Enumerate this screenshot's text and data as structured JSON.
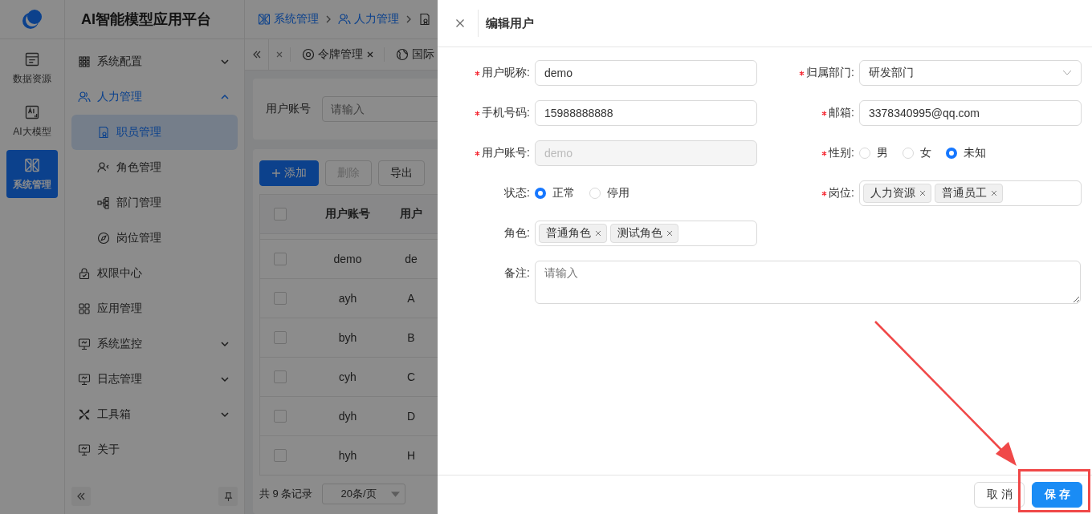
{
  "rail": {
    "items": [
      {
        "label": "数据资源",
        "selected": false
      },
      {
        "label": "AI大模型",
        "selected": false
      },
      {
        "label": "系统管理",
        "selected": true
      }
    ]
  },
  "app_title": "AI智能模型应用平台",
  "sidebar": {
    "items": [
      {
        "label": "系统配置",
        "kind": "group",
        "expanded": false,
        "selected": false
      },
      {
        "label": "人力管理",
        "kind": "group",
        "expanded": true,
        "selected": true,
        "children": [
          {
            "label": "职员管理",
            "selected": true
          },
          {
            "label": "角色管理",
            "selected": false
          },
          {
            "label": "部门管理",
            "selected": false
          },
          {
            "label": "岗位管理",
            "selected": false
          }
        ]
      },
      {
        "label": "权限中心",
        "kind": "link",
        "selected": false
      },
      {
        "label": "应用管理",
        "kind": "link",
        "selected": false
      },
      {
        "label": "系统监控",
        "kind": "group",
        "expanded": false,
        "selected": false
      },
      {
        "label": "日志管理",
        "kind": "group",
        "expanded": false,
        "selected": false
      },
      {
        "label": "工具箱",
        "kind": "group",
        "expanded": false,
        "selected": false
      },
      {
        "label": "关于",
        "kind": "link",
        "selected": false
      }
    ]
  },
  "breadcrumb": [
    "系统管理",
    "人力管理"
  ],
  "tabs": [
    {
      "label": "令牌管理",
      "selected": false
    },
    {
      "label": "国际",
      "selected": false
    }
  ],
  "search": {
    "label": "用户账号",
    "placeholder": "请输入"
  },
  "toolbar": [
    {
      "label": "添加",
      "kind": "primary",
      "disabled": false
    },
    {
      "label": "删除",
      "kind": "default",
      "disabled": true
    },
    {
      "label": "导出",
      "kind": "default",
      "disabled": false
    }
  ],
  "table": {
    "columns": [
      "用户账号",
      "用户"
    ],
    "header_checked": false,
    "rows": [
      {
        "cells": [
          "demo",
          "de"
        ],
        "checked": false
      },
      {
        "cells": [
          "ayh",
          "A"
        ],
        "checked": false
      },
      {
        "cells": [
          "byh",
          "B"
        ],
        "checked": false
      },
      {
        "cells": [
          "cyh",
          "C"
        ],
        "checked": false
      },
      {
        "cells": [
          "dyh",
          "D"
        ],
        "checked": false
      },
      {
        "cells": [
          "hyh",
          "H"
        ],
        "checked": false
      }
    ]
  },
  "pagination": {
    "total": "共 9 条记录",
    "page_size": "20条/页"
  },
  "drawer": {
    "title": "编辑用户",
    "fields": [
      {
        "label": "用户昵称:",
        "required": true,
        "kind": "text",
        "value": "demo",
        "disabled": false
      },
      {
        "label": "归属部门:",
        "required": true,
        "kind": "select",
        "value": "研发部门"
      },
      {
        "label": "手机号码:",
        "required": true,
        "kind": "text",
        "value": "15988888888",
        "disabled": false
      },
      {
        "label": "邮箱:",
        "required": true,
        "kind": "text",
        "value": "3378340995@qq.com",
        "disabled": false
      },
      {
        "label": "用户账号:",
        "required": true,
        "kind": "text",
        "value": "demo",
        "disabled": true
      },
      {
        "label": "性别:",
        "required": true,
        "kind": "radio",
        "options": [
          {
            "label": "男",
            "selected": false
          },
          {
            "label": "女",
            "selected": false
          },
          {
            "label": "未知",
            "selected": true
          }
        ]
      },
      {
        "label": "状态:",
        "required": false,
        "kind": "radio",
        "options": [
          {
            "label": "正常",
            "selected": true
          },
          {
            "label": "停用",
            "selected": false
          }
        ]
      },
      {
        "label": "岗位:",
        "required": true,
        "kind": "tags",
        "tags": [
          "人力资源",
          "普通员工"
        ]
      },
      {
        "label": "角色:",
        "required": false,
        "kind": "tags",
        "tags": [
          "普通角色",
          "测试角色"
        ]
      },
      {
        "label": "备注:",
        "required": false,
        "kind": "textarea",
        "placeholder": "请输入"
      }
    ],
    "buttons": [
      {
        "label": "取消",
        "kind": "default"
      },
      {
        "label": "保存",
        "kind": "primary"
      }
    ]
  }
}
